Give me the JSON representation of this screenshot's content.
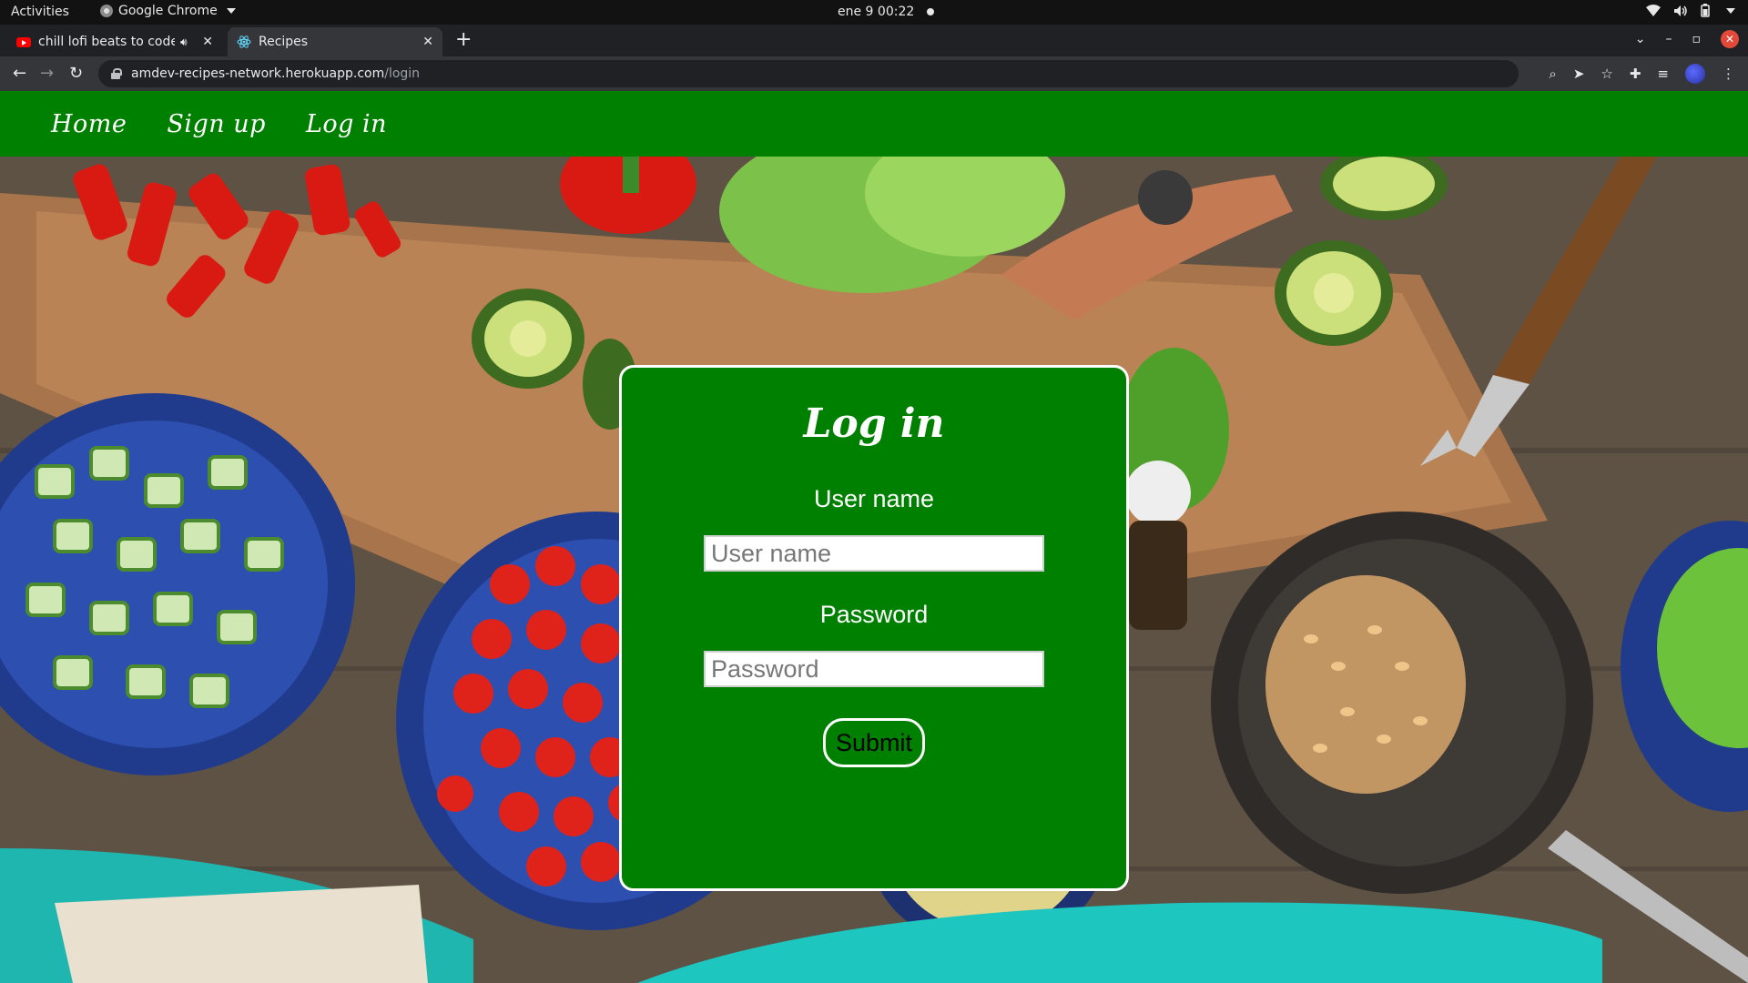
{
  "system_bar": {
    "activities": "Activities",
    "app_name": "Google Chrome",
    "clock": "ene 9  00:22"
  },
  "browser": {
    "tabs": [
      {
        "title": "chill lofi beats to code",
        "icon": "youtube-icon",
        "audio": true
      },
      {
        "title": "Recipes",
        "icon": "react-icon",
        "active": true
      }
    ],
    "url_host": "amdev-recipes-network.herokuapp.com",
    "url_path": "/login"
  },
  "site_nav": {
    "items": [
      "Home",
      "Sign up",
      "Log in"
    ]
  },
  "login": {
    "title": "Log in",
    "username_label": "User name",
    "username_placeholder": "User name",
    "password_label": "Password",
    "password_placeholder": "Password",
    "submit_label": "Submit"
  },
  "colors": {
    "brand_green": "#008000",
    "card_border": "#ffffff"
  }
}
